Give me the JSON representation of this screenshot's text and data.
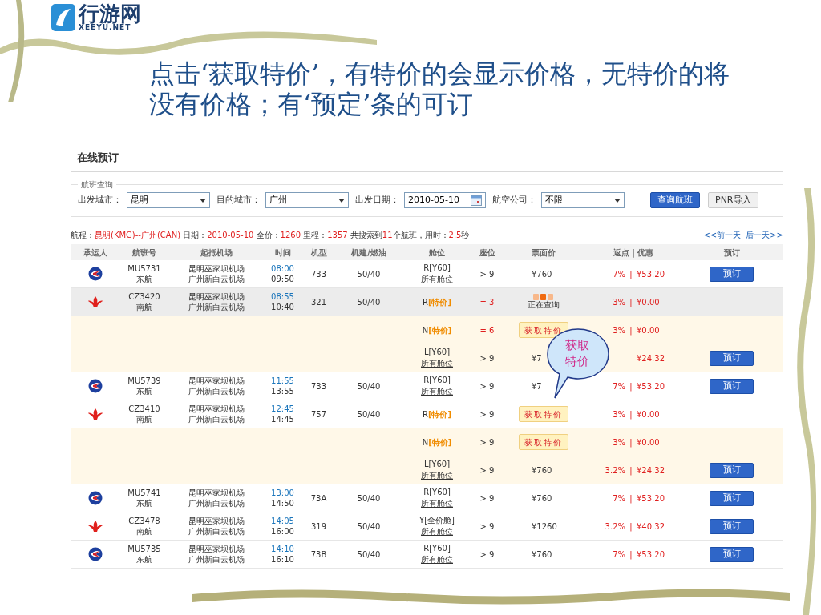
{
  "logo": {
    "name": "行游网",
    "domain": "XEEYU.NET"
  },
  "slide_title": "点击‘获取特价’，有特价的会显示价格，无特价的将没有价格；有‘预定’条的可订",
  "panel": {
    "title": "在线预订",
    "search": {
      "legend": "航班查询",
      "fields": [
        {
          "label": "出发城市：",
          "value": "昆明",
          "kind": "select"
        },
        {
          "label": "目的城市：",
          "value": "广州",
          "kind": "select"
        },
        {
          "label": "出发日期：",
          "value": "2010-05-10",
          "kind": "date"
        },
        {
          "label": "航空公司：",
          "value": "不限",
          "kind": "select"
        }
      ],
      "buttons": [
        {
          "label": "查询航班",
          "primary": true
        },
        {
          "label": "PNR导入",
          "primary": false
        }
      ]
    },
    "summary": [
      {
        "text": "航程：",
        "highlight": false
      },
      {
        "text": "昆明(KMG)--广州(CAN)",
        "highlight": true
      },
      {
        "text": " 日期：",
        "highlight": false
      },
      {
        "text": "2010-05-10",
        "highlight": true
      },
      {
        "text": " 全价：",
        "highlight": false
      },
      {
        "text": "1260",
        "highlight": true
      },
      {
        "text": " 里程：",
        "highlight": false
      },
      {
        "text": "1357",
        "highlight": true
      },
      {
        "text": " 共搜索到",
        "highlight": false
      },
      {
        "text": "11",
        "highlight": true
      },
      {
        "text": "个航班，用时：",
        "highlight": false
      },
      {
        "text": "2.5",
        "highlight": true
      },
      {
        "text": "秒",
        "highlight": false
      }
    ],
    "nav_links": [
      "<<前一天",
      "后一天>>"
    ],
    "columns": [
      "承运人",
      "航班号",
      "起抵机场",
      "时间",
      "机型",
      "机建/燃油",
      "舱位",
      "座位",
      "票面价",
      "返点 | 优惠",
      "预订"
    ],
    "rows": [
      {
        "kind": "mu",
        "highlighted": false,
        "flight_no": "MU5731",
        "airline": "东航",
        "dep_airport": "昆明巫家坝机场",
        "arr_airport": "广州新白云机场",
        "dep_time": "08:00",
        "arr_time": "09:50",
        "aircraft": "733",
        "tax": "50/40",
        "cabin": {
          "code": "R[Y60]",
          "link": "所有舱位"
        },
        "seats": {
          "text": "> 9",
          "limited": false
        },
        "price": {
          "kind": "amount",
          "text": "¥760"
        },
        "rebate": {
          "pct": "7%",
          "sep": "|",
          "amt": "¥53.20"
        },
        "book": "预订"
      },
      {
        "kind": "cz",
        "highlighted": true,
        "flight_no": "CZ3420",
        "airline": "南航",
        "dep_airport": "昆明巫家坝机场",
        "arr_airport": "广州新白云机场",
        "dep_time": "08:55",
        "arr_time": "10:40",
        "aircraft": "321",
        "tax": "50/40",
        "cabin": {
          "code": "R",
          "tag": "[特价]"
        },
        "seats": {
          "text": "= 3",
          "limited": true
        },
        "price": {
          "kind": "querying",
          "text": "正在查询"
        },
        "rebate": {
          "pct": "3%",
          "sep": "|",
          "amt": "¥0.00"
        }
      },
      {
        "kind": "fare",
        "cabin": {
          "code": "N",
          "tag": "[特价]"
        },
        "seats": {
          "text": "= 6",
          "limited": true
        },
        "price": {
          "kind": "button",
          "text": "获取特价"
        },
        "rebate": {
          "pct": "3%",
          "sep": "|",
          "amt": "¥0.00"
        }
      },
      {
        "kind": "fare",
        "cabin": {
          "code": "L[Y60]",
          "link": "所有舱位"
        },
        "seats": {
          "text": "> 9",
          "limited": false
        },
        "price": {
          "kind": "amount",
          "text": "¥7"
        },
        "rebate": {
          "amt": "¥24.32"
        },
        "book": "预订"
      },
      {
        "kind": "mu",
        "highlighted": false,
        "flight_no": "MU5739",
        "airline": "东航",
        "dep_airport": "昆明巫家坝机场",
        "arr_airport": "广州新白云机场",
        "dep_time": "11:55",
        "arr_time": "13:55",
        "aircraft": "733",
        "tax": "50/40",
        "cabin": {
          "code": "R[Y60]",
          "link": "所有舱位"
        },
        "seats": {
          "text": "> 9",
          "limited": false
        },
        "price": {
          "kind": "amount",
          "text": "¥7"
        },
        "rebate": {
          "pct": "7%",
          "sep": "|",
          "amt": "¥53.20"
        },
        "book": "预订"
      },
      {
        "kind": "cz",
        "highlighted": false,
        "flight_no": "CZ3410",
        "airline": "南航",
        "dep_airport": "昆明巫家坝机场",
        "arr_airport": "广州新白云机场",
        "dep_time": "12:45",
        "arr_time": "14:45",
        "aircraft": "757",
        "tax": "50/40",
        "cabin": {
          "code": "R",
          "tag": "[特价]"
        },
        "seats": {
          "text": "> 9",
          "limited": false
        },
        "price": {
          "kind": "button",
          "text": "获取特价"
        },
        "rebate": {
          "pct": "3%",
          "sep": "|",
          "amt": "¥0.00"
        }
      },
      {
        "kind": "fare",
        "cabin": {
          "code": "N",
          "tag": "[特价]"
        },
        "seats": {
          "text": "> 9",
          "limited": false
        },
        "price": {
          "kind": "button",
          "text": "获取特价"
        },
        "rebate": {
          "pct": "3%",
          "sep": "|",
          "amt": "¥0.00"
        }
      },
      {
        "kind": "fare",
        "cabin": {
          "code": "L[Y60]",
          "link": "所有舱位"
        },
        "seats": {
          "text": "> 9",
          "limited": false
        },
        "price": {
          "kind": "amount",
          "text": "¥760"
        },
        "rebate": {
          "pct": "3.2%",
          "sep": "|",
          "amt": "¥24.32"
        },
        "book": "预订"
      },
      {
        "kind": "mu",
        "highlighted": false,
        "flight_no": "MU5741",
        "airline": "东航",
        "dep_airport": "昆明巫家坝机场",
        "arr_airport": "广州新白云机场",
        "dep_time": "13:00",
        "arr_time": "14:50",
        "aircraft": "73A",
        "tax": "50/40",
        "cabin": {
          "code": "R[Y60]",
          "link": "所有舱位"
        },
        "seats": {
          "text": "> 9",
          "limited": false
        },
        "price": {
          "kind": "amount",
          "text": "¥760"
        },
        "rebate": {
          "pct": "7%",
          "sep": "|",
          "amt": "¥53.20"
        },
        "book": "预订"
      },
      {
        "kind": "cz",
        "highlighted": false,
        "flight_no": "CZ3478",
        "airline": "南航",
        "dep_airport": "昆明巫家坝机场",
        "arr_airport": "广州新白云机场",
        "dep_time": "14:05",
        "arr_time": "16:00",
        "aircraft": "319",
        "tax": "50/40",
        "cabin": {
          "code": "Y[全价舱]",
          "link": "所有舱位"
        },
        "seats": {
          "text": "> 9",
          "limited": false
        },
        "price": {
          "kind": "amount",
          "text": "¥1260"
        },
        "rebate": {
          "pct": "3.2%",
          "sep": "|",
          "amt": "¥40.32"
        },
        "book": "预订"
      },
      {
        "kind": "mu",
        "highlighted": false,
        "flight_no": "MU5735",
        "airline": "东航",
        "dep_airport": "昆明巫家坝机场",
        "arr_airport": "广州新白云机场",
        "dep_time": "14:10",
        "arr_time": "16:10",
        "aircraft": "73B",
        "tax": "50/40",
        "cabin": {
          "code": "R[Y60]",
          "link": "所有舱位"
        },
        "seats": {
          "text": "> 9",
          "limited": false
        },
        "price": {
          "kind": "amount",
          "text": "¥760"
        },
        "rebate": {
          "pct": "7%",
          "sep": "|",
          "amt": "¥53.20"
        },
        "book": "预订"
      }
    ],
    "callout": "获取特价"
  }
}
